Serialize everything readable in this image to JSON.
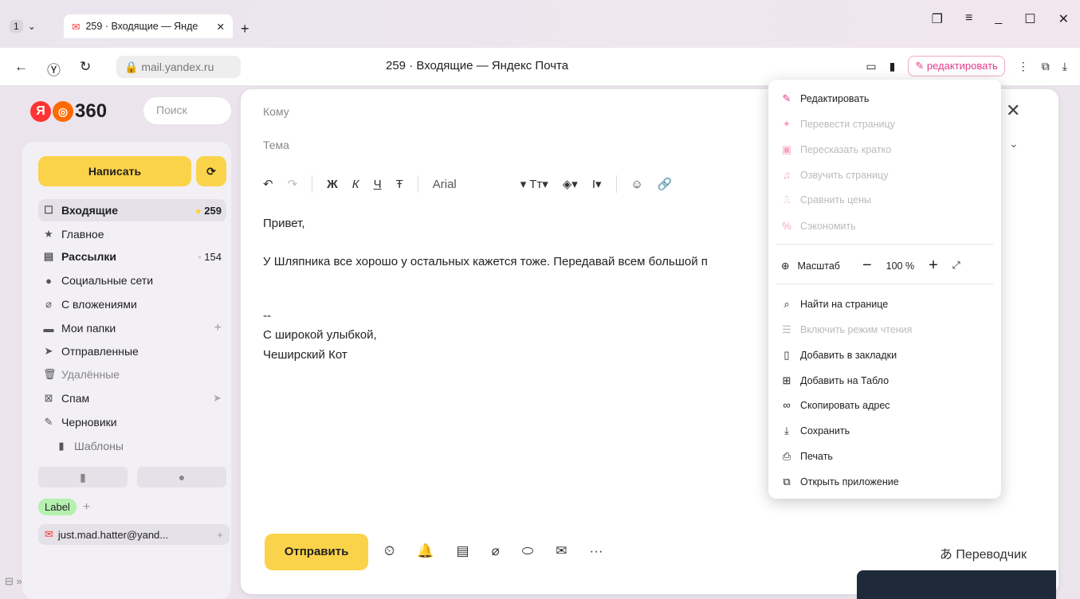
{
  "browser": {
    "tab_count": "1",
    "tab_title": "259 · Входящие — Янде",
    "url": "mail.yandex.ru",
    "page_title": "259 · Входящие — Яндекс Почта",
    "edit_label": "редактировать"
  },
  "sidebar": {
    "logo": "360",
    "search_placeholder": "Поиск",
    "compose_label": "Написать",
    "folders": [
      {
        "label": "Входящие",
        "count": "259"
      },
      {
        "label": "Главное",
        "count": ""
      },
      {
        "label": "Рассылки",
        "count": "154"
      },
      {
        "label": "Социальные сети",
        "count": ""
      },
      {
        "label": "С вложениями",
        "count": ""
      },
      {
        "label": "Мои папки",
        "count": ""
      },
      {
        "label": "Отправленные",
        "count": ""
      },
      {
        "label": "Удалённые",
        "count": ""
      },
      {
        "label": "Спам",
        "count": ""
      },
      {
        "label": "Черновики",
        "count": ""
      },
      {
        "label": "Шаблоны",
        "count": ""
      }
    ],
    "label_chip": "Label",
    "account": "just.mad.hatter@yand..."
  },
  "compose": {
    "to_placeholder": "Кому",
    "subject_placeholder": "Тема",
    "font": "Arial",
    "body": [
      "Привет,",
      "У Шляпника все хорошо у остальных кажется тоже. Передавай всем большой п",
      "--",
      "С широкой улыбкой,",
      "Чеширский Кот"
    ],
    "send_label": "Отправить",
    "translator_label": "Переводчик"
  },
  "menu": {
    "items_top": [
      {
        "label": "Редактировать",
        "enabled": true
      },
      {
        "label": "Перевести страницу",
        "enabled": false
      },
      {
        "label": "Пересказать кратко",
        "enabled": false
      },
      {
        "label": "Озвучить страницу",
        "enabled": false
      },
      {
        "label": "Сравнить цены",
        "enabled": false
      },
      {
        "label": "Сэкономить",
        "enabled": false
      }
    ],
    "zoom_label": "Масштаб",
    "zoom_value": "100 %",
    "items_bottom": [
      {
        "label": "Найти на странице",
        "enabled": true
      },
      {
        "label": "Включить режим чтения",
        "enabled": false
      },
      {
        "label": "Добавить в закладки",
        "enabled": true
      },
      {
        "label": "Добавить на Табло",
        "enabled": true
      },
      {
        "label": "Скопировать адрес",
        "enabled": true
      },
      {
        "label": "Сохранить",
        "enabled": true
      },
      {
        "label": "Печать",
        "enabled": true
      },
      {
        "label": "Открыть приложение",
        "enabled": true
      }
    ]
  },
  "colors": {
    "accent_yellow": "#fbd34a",
    "menu_pink": "#e63a8a",
    "label_green": "#b6f0b0"
  }
}
